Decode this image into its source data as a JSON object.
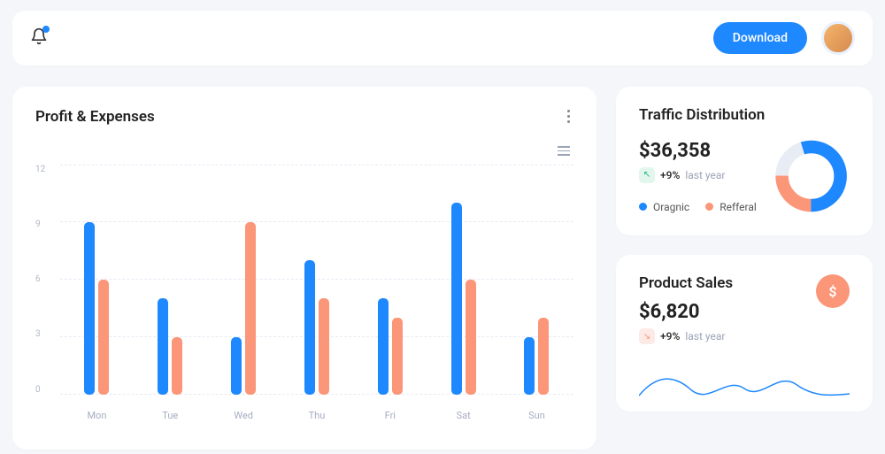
{
  "topbar": {
    "download_label": "Download"
  },
  "profit_expenses": {
    "title": "Profit & Expenses"
  },
  "traffic": {
    "title": "Traffic Distribution",
    "value": "$36,358",
    "change": "+9%",
    "change_label": "last year",
    "legend_a": "Oragnic",
    "legend_b": "Refferal"
  },
  "sales": {
    "title": "Product Sales",
    "value": "$6,820",
    "change": "+9%",
    "change_label": "last year",
    "badge_symbol": "$"
  },
  "chart_data": [
    {
      "id": "profit_expenses",
      "type": "bar",
      "categories": [
        "Mon",
        "Tue",
        "Wed",
        "Thu",
        "Fri",
        "Sat",
        "Sun"
      ],
      "series": [
        {
          "name": "Profit",
          "color": "#1e88ff",
          "values": [
            9,
            5,
            3,
            7,
            5,
            10,
            3
          ]
        },
        {
          "name": "Expenses",
          "color": "#fb9678",
          "values": [
            6,
            3,
            9,
            5,
            4,
            6,
            4
          ]
        }
      ],
      "ylim": [
        0,
        12
      ],
      "yticks": [
        0,
        3,
        6,
        9,
        12
      ],
      "xlabel": "",
      "ylabel": ""
    },
    {
      "id": "traffic_distribution",
      "type": "pie",
      "series": [
        {
          "name": "Oragnic",
          "color": "#1e88ff",
          "value": 55
        },
        {
          "name": "Refferal",
          "color": "#fb9678",
          "value": 25
        },
        {
          "name": "Other",
          "color": "#e8ecf4",
          "value": 20
        }
      ]
    },
    {
      "id": "product_sales_spark",
      "type": "line",
      "x": [
        0,
        1,
        2,
        3,
        4,
        5,
        6,
        7
      ],
      "values": [
        12,
        28,
        14,
        30,
        18,
        34,
        20,
        14
      ],
      "color": "#1e88ff"
    }
  ]
}
